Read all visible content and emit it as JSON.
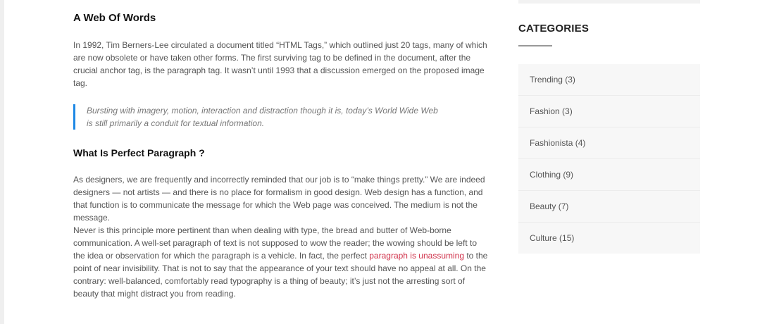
{
  "article": {
    "heading1": "A Web Of Words",
    "paragraph1": "In 1992, Tim Berners-Lee circulated a document titled “HTML Tags,” which outlined just 20 tags, many of which are now obsolete or have taken other forms. The first surviving tag to be defined in the document, after the crucial anchor tag, is the paragraph tag. It wasn’t until 1993 that a discussion emerged on the proposed image tag.",
    "quote": "Bursting with imagery, motion, interaction and distraction though it is, today’s World Wide Web is still primarily a conduit for textual information.",
    "heading2": "What Is Perfect Paragraph ?",
    "paragraph2": "As designers, we are frequently and incorrectly reminded that our job is to “make things pretty.” We are indeed designers — not artists — and there is no place for formalism in good design. Web design has a function, and that function is to communicate the message for which the Web page was conceived. The medium is not the message.",
    "paragraph3_before": "Never is this principle more pertinent than when dealing with type, the bread and butter of Web-borne communication. A well-set paragraph of text is not supposed to wow the reader; the wowing should be left to the idea or observation for which the paragraph is a vehicle. In fact, the perfect ",
    "paragraph3_link": "paragraph is unassuming",
    "paragraph3_after": " to the point of near invisibility. That is not to say that the appearance of your text should have no appeal at all. On the contrary: well-balanced, comfortably read typography is a thing of beauty; it’s just not the arresting sort of beauty that might distract you from reading."
  },
  "sidebar": {
    "categories_heading": "CATEGORIES",
    "categories": [
      {
        "label": "Trending (3)"
      },
      {
        "label": "Fashion (3)"
      },
      {
        "label": "Fashionista (4)"
      },
      {
        "label": "Clothing (9)"
      },
      {
        "label": "Beauty (7)"
      },
      {
        "label": "Culture (15)"
      }
    ]
  },
  "colors": {
    "link": "#d0314a",
    "quote_border": "#1e88e5"
  }
}
